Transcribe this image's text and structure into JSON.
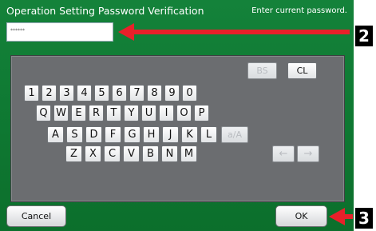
{
  "header": {
    "title": "Operation Setting Password Verification",
    "hint": "Enter current password."
  },
  "password_field": {
    "value": "******"
  },
  "keyboard": {
    "control_keys": [
      "BS",
      "CL"
    ],
    "row1": [
      "1",
      "2",
      "3",
      "4",
      "5",
      "6",
      "7",
      "8",
      "9",
      "0"
    ],
    "row2": [
      "Q",
      "W",
      "E",
      "R",
      "T",
      "Y",
      "U",
      "I",
      "O",
      "P"
    ],
    "row3": [
      "A",
      "S",
      "D",
      "F",
      "G",
      "H",
      "J",
      "K",
      "L",
      "a/A"
    ],
    "row4": [
      "Z",
      "X",
      "C",
      "V",
      "B",
      "N",
      "M",
      "←",
      "→"
    ]
  },
  "footer": {
    "cancel_label": "Cancel",
    "ok_label": "OK"
  },
  "callouts": {
    "step2": "2",
    "step3": "3"
  },
  "colors": {
    "background": "#0f7a33",
    "arrow": "#e8202a",
    "keyboard_panel": "#6b6d70"
  }
}
